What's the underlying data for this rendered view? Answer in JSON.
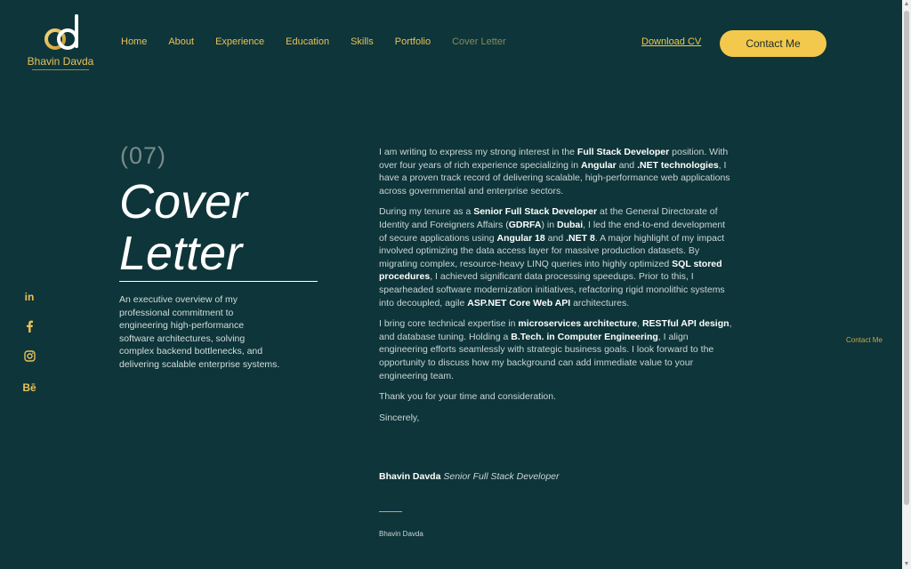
{
  "brand": {
    "name": "Bhavin Davda",
    "gold": "#e8c15a",
    "bg": "#0e3539"
  },
  "nav": [
    {
      "label": "Home"
    },
    {
      "label": "About"
    },
    {
      "label": "Experience"
    },
    {
      "label": "Education"
    },
    {
      "label": "Skills"
    },
    {
      "label": "Portfolio"
    },
    {
      "label": "Cover Letter"
    }
  ],
  "header": {
    "download_cv": "Download CV",
    "contact_me": "Contact Me"
  },
  "socials": [
    "linkedin-icon",
    "facebook-icon",
    "instagram-icon",
    "behance-icon"
  ],
  "section": {
    "number": "(07)",
    "title_line1": "Cover",
    "title_line2": "Letter",
    "summary": "An executive overview of my professional commitment to engineering high-performance software architectures, solving complex backend bottlenecks, and delivering scalable enterprise systems."
  },
  "letter": {
    "p1": [
      "I am writing to express my strong interest in the ",
      "Full Stack Developer",
      " position. With over four years of rich experience specializing in ",
      "Angular",
      " and ",
      ".NET technologies",
      ", I have a proven track record of delivering scalable, high-performance web applications across governmental and enterprise sectors."
    ],
    "p2": [
      "During my tenure as a ",
      "Senior Full Stack Developer",
      " at the General Directorate of Identity and Foreigners Affairs (",
      "GDRFA",
      ") in ",
      "Dubai",
      ", I led the end-to-end development of secure applications using ",
      "Angular 18",
      " and ",
      ".NET 8",
      ". A major highlight of my impact involved optimizing the data access layer for massive production datasets. By migrating complex, resource-heavy LINQ queries into highly optimized ",
      "SQL stored procedures",
      ", I achieved significant data processing speedups. Prior to this, I spearheaded software modernization initiatives, refactoring rigid monolithic systems into decoupled, agile ",
      "ASP.NET Core Web API",
      " architectures."
    ],
    "p3": [
      "I bring core technical expertise in ",
      "microservices architecture",
      ", ",
      "RESTful API design",
      ", and database tuning. Holding a ",
      "B.Tech. in Computer Engineering",
      ", I align engineering efforts seamlessly with strategic business goals. I look forward to the opportunity to discuss how my background can add immediate value to your engineering team."
    ],
    "p4": "Thank you for your time and consideration.",
    "p5": "Sincerely,",
    "sig_name": "Bhavin Davda",
    "sig_title": "Senior Full Stack Developer",
    "sig_small": "Bhavin Davda"
  },
  "side_contact": "Contact Me"
}
